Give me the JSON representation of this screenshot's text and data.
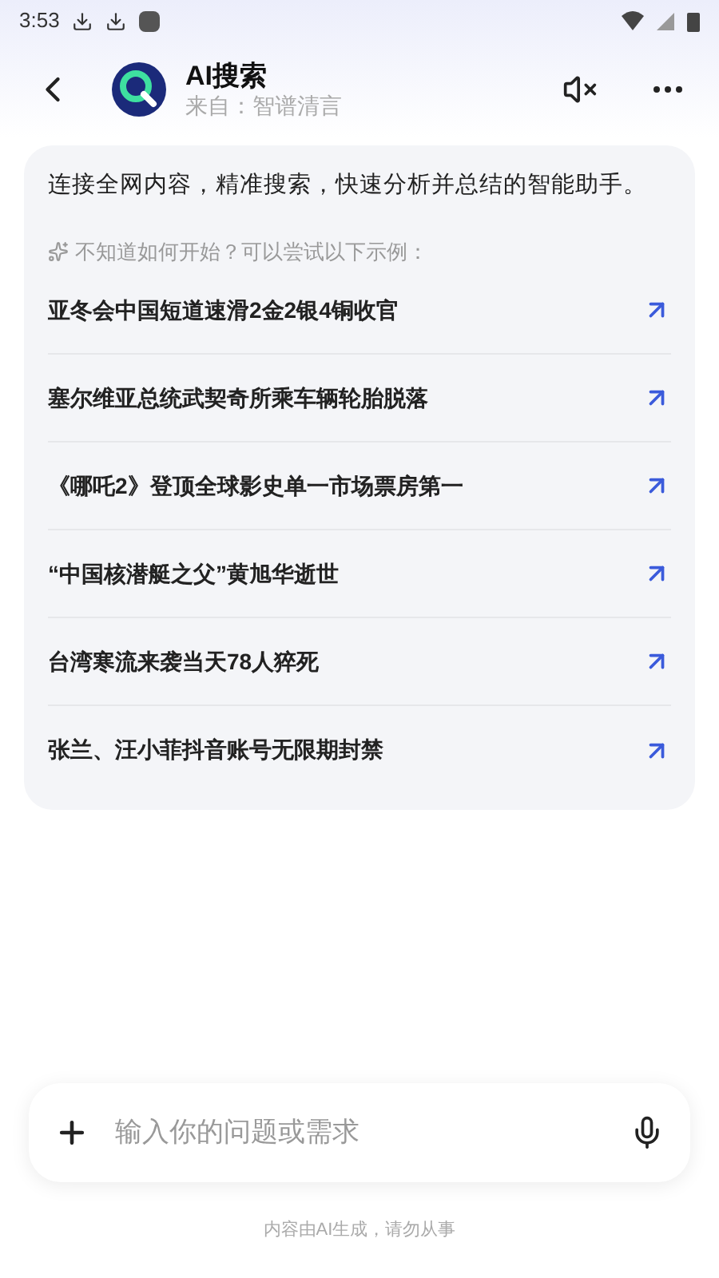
{
  "status_bar": {
    "time": "3:53"
  },
  "header": {
    "title": "AI搜索",
    "subtitle": "来自：智谱清言"
  },
  "intro": "连接全网内容，精准搜索，快速分析并总结的智能助手。",
  "hint": "不知道如何开始？可以尝试以下示例：",
  "examples": [
    "亚冬会中国短道速滑2金2银4铜收官",
    "塞尔维亚总统武契奇所乘车辆轮胎脱落",
    "《哪吒2》登顶全球影史单一市场票房第一",
    "“中国核潜艇之父”黄旭华逝世",
    "台湾寒流来袭当天78人猝死",
    "张兰、汪小菲抖音账号无限期封禁"
  ],
  "input": {
    "placeholder": "输入你的问题或需求"
  },
  "footer": "内容由AI生成，请勿从事"
}
